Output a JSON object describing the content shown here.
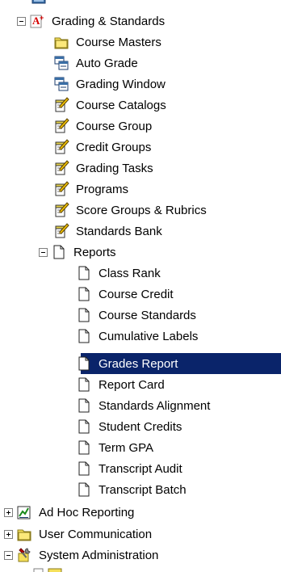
{
  "tree": {
    "grading": "Grading & Standards",
    "course_masters": "Course Masters",
    "auto_grade": "Auto Grade",
    "grading_window": "Grading Window",
    "course_catalogs": "Course Catalogs",
    "course_group": "Course Group",
    "credit_groups": "Credit Groups",
    "grading_tasks": "Grading Tasks",
    "programs": "Programs",
    "score_groups": "Score Groups & Rubrics",
    "standards_bank": "Standards Bank",
    "reports": "Reports",
    "report_items": [
      "Class Rank",
      "Course Credit",
      "Course Standards",
      "Cumulative Labels",
      "Grades Report",
      "Report Card",
      "Standards Alignment",
      "Student Credits",
      "Term GPA",
      "Transcript Audit",
      "Transcript Batch"
    ],
    "ad_hoc": "Ad Hoc Reporting",
    "user_comm": "User Communication",
    "system_admin": "System Administration"
  },
  "colors": {
    "selection": "#0a246a",
    "folder": "#f5e05a",
    "report_red": "#d40000"
  }
}
